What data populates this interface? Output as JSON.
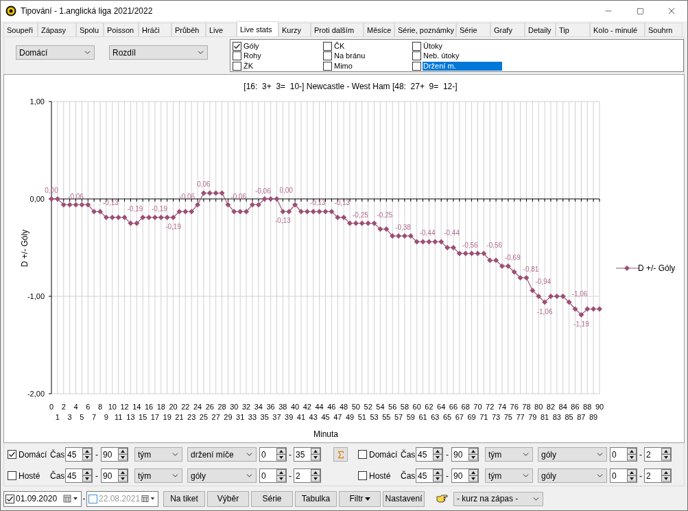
{
  "window": {
    "title": "Tipování - 1.anglická liga 2021/2022"
  },
  "tabs": [
    {
      "label": "Soupeři",
      "selected": false
    },
    {
      "label": "Zápasy",
      "selected": false
    },
    {
      "label": "Spolu",
      "selected": false
    },
    {
      "label": "Poisson",
      "selected": false
    },
    {
      "label": "Hráči",
      "selected": false
    },
    {
      "label": "Průběh",
      "selected": false
    },
    {
      "label": "Live",
      "selected": false
    },
    {
      "label": "Live stats",
      "selected": true
    },
    {
      "label": "Kurzy",
      "selected": false
    },
    {
      "label": "Proti dalším",
      "selected": false
    },
    {
      "label": "Měsíce",
      "selected": false
    },
    {
      "label": "Série, poznámky",
      "selected": false
    },
    {
      "label": "Série",
      "selected": false
    },
    {
      "label": "Grafy",
      "selected": false
    },
    {
      "label": "Detaily",
      "selected": false
    },
    {
      "label": "Tip",
      "selected": false
    },
    {
      "label": "Kolo - minulé",
      "selected": false
    },
    {
      "label": "Souhrn",
      "selected": false
    }
  ],
  "view_selects": [
    {
      "value": "Domácí"
    },
    {
      "value": "Rozdíl"
    }
  ],
  "stat_options": [
    {
      "label": "Góly",
      "checked": true,
      "highlighted": false
    },
    {
      "label": "Rohy",
      "checked": false,
      "highlighted": false
    },
    {
      "label": "ŽK",
      "checked": false,
      "highlighted": false
    },
    {
      "label": "ČK",
      "checked": false,
      "highlighted": false
    },
    {
      "label": "Na bránu",
      "checked": false,
      "highlighted": false
    },
    {
      "label": "Mimo",
      "checked": false,
      "highlighted": false
    },
    {
      "label": "Útoky",
      "checked": false,
      "highlighted": false
    },
    {
      "label": "Neb. útoky",
      "checked": false,
      "highlighted": false
    },
    {
      "label": "Držení m.",
      "checked": false,
      "highlighted": true
    }
  ],
  "chart": {
    "chart_data": {
      "type": "line",
      "title": "[16:  3+  3=  10-] Newcastle - West Ham [48:  27+  9=  12-]",
      "xlabel": "Minuta",
      "ylabel": "D +/- Góly",
      "grid": true,
      "ylim": [
        -2,
        1
      ],
      "categories": [
        "0",
        "1",
        "2",
        "3",
        "4",
        "5",
        "6",
        "7",
        "8",
        "9",
        "10",
        "11",
        "12",
        "13",
        "14",
        "15",
        "16",
        "17",
        "18",
        "19",
        "20",
        "21",
        "22",
        "23",
        "24",
        "25",
        "26",
        "27",
        "28",
        "29",
        "30",
        "31",
        "32",
        "33",
        "34",
        "35",
        "36",
        "37",
        "38",
        "39",
        "40",
        "41",
        "42",
        "43",
        "44",
        "45",
        "46",
        "47",
        "48",
        "49",
        "50",
        "51",
        "52",
        "53",
        "54",
        "55",
        "56",
        "57",
        "58",
        "59",
        "60",
        "61",
        "62",
        "63",
        "64",
        "65",
        "66",
        "67",
        "68",
        "69",
        "70",
        "71",
        "72",
        "73",
        "74",
        "75",
        "76",
        "77",
        "78",
        "79",
        "80",
        "81",
        "82",
        "83",
        "84",
        "85",
        "86",
        "87",
        "88",
        "89",
        "90"
      ],
      "yticks": [
        {
          "value": 1,
          "label": "1,00"
        },
        {
          "value": 0,
          "label": "0,00"
        },
        {
          "value": -1,
          "label": "-1,00"
        },
        {
          "value": -2,
          "label": "-2,00"
        }
      ],
      "series": [
        {
          "name": "D +/- Góly",
          "color": "#9c4f75",
          "marker": "diamond",
          "values": [
            0,
            0,
            -0.06,
            -0.06,
            -0.06,
            -0.06,
            -0.06,
            -0.13,
            -0.13,
            -0.19,
            -0.19,
            -0.19,
            -0.19,
            -0.25,
            -0.25,
            -0.19,
            -0.19,
            -0.19,
            -0.19,
            -0.19,
            -0.19,
            -0.13,
            -0.13,
            -0.13,
            -0.06,
            0.06,
            0.06,
            0.06,
            0.06,
            -0.06,
            -0.13,
            -0.13,
            -0.13,
            -0.06,
            -0.06,
            0,
            0,
            0,
            -0.13,
            -0.13,
            -0.06,
            -0.13,
            -0.13,
            -0.13,
            -0.13,
            -0.13,
            -0.13,
            -0.19,
            -0.19,
            -0.25,
            -0.25,
            -0.25,
            -0.25,
            -0.25,
            -0.31,
            -0.31,
            -0.38,
            -0.38,
            -0.38,
            -0.38,
            -0.44,
            -0.44,
            -0.44,
            -0.44,
            -0.44,
            -0.5,
            -0.5,
            -0.56,
            -0.56,
            -0.56,
            -0.56,
            -0.56,
            -0.63,
            -0.63,
            -0.69,
            -0.69,
            -0.75,
            -0.81,
            -0.81,
            -0.94,
            -1,
            -1.06,
            -1,
            -1,
            -1,
            -1.06,
            -1.13,
            -1.19,
            -1.13,
            -1.13,
            -1.13
          ]
        }
      ],
      "value_labels": [
        "0,00",
        null,
        null,
        null,
        "-0,06",
        null,
        null,
        null,
        "-0,13",
        null,
        null,
        null,
        "-0,19",
        null,
        null,
        null,
        "-0,19",
        null,
        null,
        null,
        "-0,19",
        null,
        null,
        null,
        "-0,06",
        "0,06",
        null,
        null,
        null,
        "-0,06",
        null,
        null,
        null,
        "-0,06",
        null,
        null,
        null,
        "0,00",
        "-0,13",
        null,
        null,
        null,
        "-0,13",
        null,
        null,
        null,
        "-0,13",
        null,
        null,
        "-0,25",
        null,
        null,
        null,
        "-0,25",
        null,
        null,
        "-0,38",
        null,
        null,
        null,
        "-0,44",
        null,
        null,
        null,
        "-0,44",
        null,
        null,
        "-0,56",
        null,
        null,
        null,
        "-0,56",
        null,
        null,
        "-0,69",
        null,
        null,
        "-0,81",
        null,
        "-0,94",
        null,
        "-1,06",
        null,
        null,
        null,
        "-1,06",
        null,
        "-1,19",
        null,
        null,
        null
      ]
    }
  },
  "filter_rows": [
    {
      "sum_button": true,
      "groups": [
        {
          "checked": true,
          "team": "Domácí",
          "time_label": "Čas",
          "minute_from": "45",
          "time_separator": "-",
          "minute_to": "90",
          "scope": "tým",
          "stat": "držení míče",
          "min": "0",
          "value_separator": "-",
          "max": "35"
        },
        {
          "checked": false,
          "team": "Domácí",
          "time_label": "Čas",
          "minute_from": "45",
          "time_separator": "-",
          "minute_to": "90",
          "scope": "tým",
          "stat": "góly",
          "min": "0",
          "value_separator": "-",
          "max": "2"
        }
      ]
    },
    {
      "sum_button": false,
      "groups": [
        {
          "checked": false,
          "team": "Hosté",
          "time_label": "Čas",
          "minute_from": "45",
          "time_separator": "-",
          "minute_to": "90",
          "scope": "tým",
          "stat": "góly",
          "min": "0",
          "value_separator": "-",
          "max": "2"
        },
        {
          "checked": false,
          "team": "Hosté",
          "time_label": "Čas",
          "minute_from": "45",
          "time_separator": "-",
          "minute_to": "90",
          "scope": "tým",
          "stat": "góly",
          "min": "0",
          "value_separator": "-",
          "max": "2"
        }
      ]
    }
  ],
  "date_range": {
    "from": {
      "checked": true,
      "value": "01.09.2020"
    },
    "separator": "-",
    "to": {
      "checked": false,
      "value": "22.08.2021"
    }
  },
  "buttons": [
    {
      "label": "Na tiket",
      "kind": "plain"
    },
    {
      "label": "Výběr",
      "kind": "plain"
    },
    {
      "label": "Série",
      "kind": "plain"
    },
    {
      "label": "Tabulka",
      "kind": "plain"
    },
    {
      "label": "Filtr",
      "kind": "menu"
    },
    {
      "label": "Nastavení",
      "kind": "plain"
    }
  ],
  "odds_select": {
    "value": "- kurz na zápas -"
  }
}
